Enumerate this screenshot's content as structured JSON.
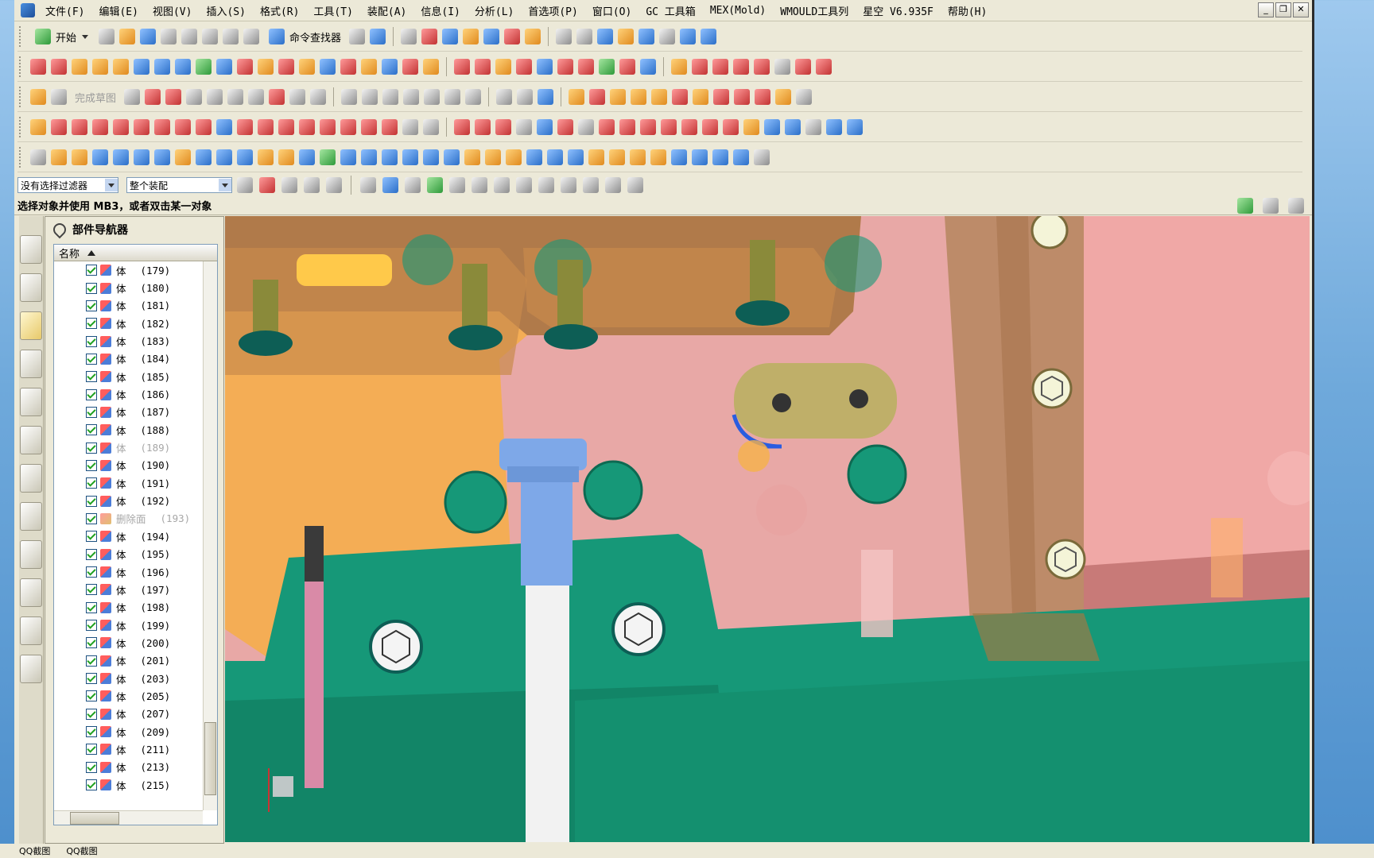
{
  "menubar": {
    "items": [
      "文件(F)",
      "编辑(E)",
      "视图(V)",
      "插入(S)",
      "格式(R)",
      "工具(T)",
      "装配(A)",
      "信息(I)",
      "分析(L)",
      "首选项(P)",
      "窗口(O)",
      "GC 工具箱",
      "MEX(Mold)",
      "WMOULD工具列",
      "星空 V6.935F",
      "帮助(H)"
    ]
  },
  "toolbar": {
    "start_label": "开始",
    "command_finder_label": "命令查找器",
    "finish_sketch_label": "完成草图"
  },
  "selection": {
    "filter_value": "没有选择过滤器",
    "scope_value": "整个装配"
  },
  "status": {
    "prompt": "选择对象并使用 MB3，或者双击某一对象"
  },
  "navigator": {
    "title": "部件导航器",
    "column_name": "名称",
    "rows": [
      {
        "name": "体",
        "num": "(179)",
        "dim": false,
        "type": "body"
      },
      {
        "name": "体",
        "num": "(180)",
        "dim": false,
        "type": "body"
      },
      {
        "name": "体",
        "num": "(181)",
        "dim": false,
        "type": "body"
      },
      {
        "name": "体",
        "num": "(182)",
        "dim": false,
        "type": "body"
      },
      {
        "name": "体",
        "num": "(183)",
        "dim": false,
        "type": "body"
      },
      {
        "name": "体",
        "num": "(184)",
        "dim": false,
        "type": "body"
      },
      {
        "name": "体",
        "num": "(185)",
        "dim": false,
        "type": "body"
      },
      {
        "name": "体",
        "num": "(186)",
        "dim": false,
        "type": "body"
      },
      {
        "name": "体",
        "num": "(187)",
        "dim": false,
        "type": "body"
      },
      {
        "name": "体",
        "num": "(188)",
        "dim": false,
        "type": "body"
      },
      {
        "name": "体",
        "num": "(189)",
        "dim": true,
        "type": "body"
      },
      {
        "name": "体",
        "num": "(190)",
        "dim": false,
        "type": "body"
      },
      {
        "name": "体",
        "num": "(191)",
        "dim": false,
        "type": "body"
      },
      {
        "name": "体",
        "num": "(192)",
        "dim": false,
        "type": "body"
      },
      {
        "name": "删除面",
        "num": "(193)",
        "dim": true,
        "type": "delete-face"
      },
      {
        "name": "体",
        "num": "(194)",
        "dim": false,
        "type": "body"
      },
      {
        "name": "体",
        "num": "(195)",
        "dim": false,
        "type": "body"
      },
      {
        "name": "体",
        "num": "(196)",
        "dim": false,
        "type": "body"
      },
      {
        "name": "体",
        "num": "(197)",
        "dim": false,
        "type": "body"
      },
      {
        "name": "体",
        "num": "(198)",
        "dim": false,
        "type": "body"
      },
      {
        "name": "体",
        "num": "(199)",
        "dim": false,
        "type": "body"
      },
      {
        "name": "体",
        "num": "(200)",
        "dim": false,
        "type": "body"
      },
      {
        "name": "体",
        "num": "(201)",
        "dim": false,
        "type": "body"
      },
      {
        "name": "体",
        "num": "(203)",
        "dim": false,
        "type": "body"
      },
      {
        "name": "体",
        "num": "(205)",
        "dim": false,
        "type": "body"
      },
      {
        "name": "体",
        "num": "(207)",
        "dim": false,
        "type": "body"
      },
      {
        "name": "体",
        "num": "(209)",
        "dim": false,
        "type": "body"
      },
      {
        "name": "体",
        "num": "(211)",
        "dim": false,
        "type": "body"
      },
      {
        "name": "体",
        "num": "(213)",
        "dim": false,
        "type": "body"
      },
      {
        "name": "体",
        "num": "(215)",
        "dim": false,
        "type": "body"
      }
    ]
  },
  "taskbar": {
    "items": [
      "QQ截图",
      "QQ截图"
    ]
  },
  "colors": {
    "pink_plate": "#e8a8a6",
    "orange_plate": "#f4ad55",
    "brown_plate": "#b07a4a",
    "green_plate": "#169878",
    "blue_pin": "#7ea8e8"
  }
}
